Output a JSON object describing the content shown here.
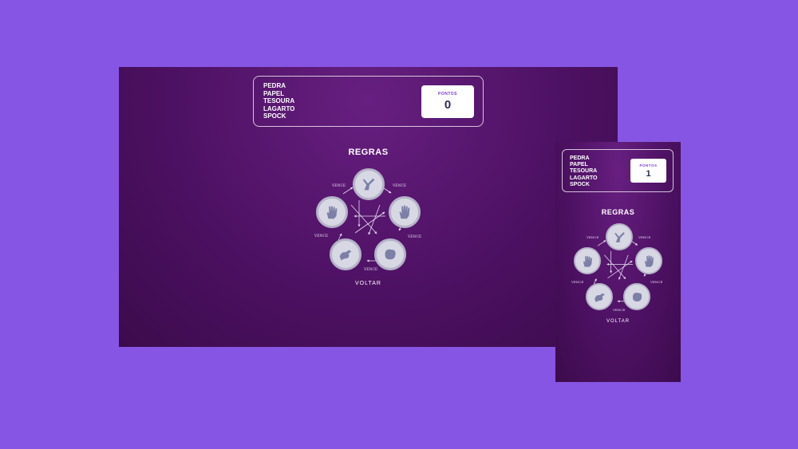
{
  "game": {
    "choices": [
      "PEDRA",
      "PAPEL",
      "TESOURA",
      "LAGARTO",
      "SPOCK"
    ],
    "score_label": "PONTOS",
    "rules_title": "REGRAS",
    "beats_label": "VENCE",
    "back_label": "VOLTAR"
  },
  "desktop": {
    "score": "0"
  },
  "mobile": {
    "score": "1"
  },
  "icons": [
    "scissors-icon",
    "paper-hand-icon",
    "rock-fist-icon",
    "lizard-hand-icon",
    "spock-hand-icon"
  ],
  "colors": {
    "background": "#8655e3",
    "screen": "#4d1163",
    "accent": "#7a3ad0",
    "score_text": "#2a2f55",
    "node_fill": "#d8d8e4",
    "node_ring": "#b5b3c8"
  }
}
